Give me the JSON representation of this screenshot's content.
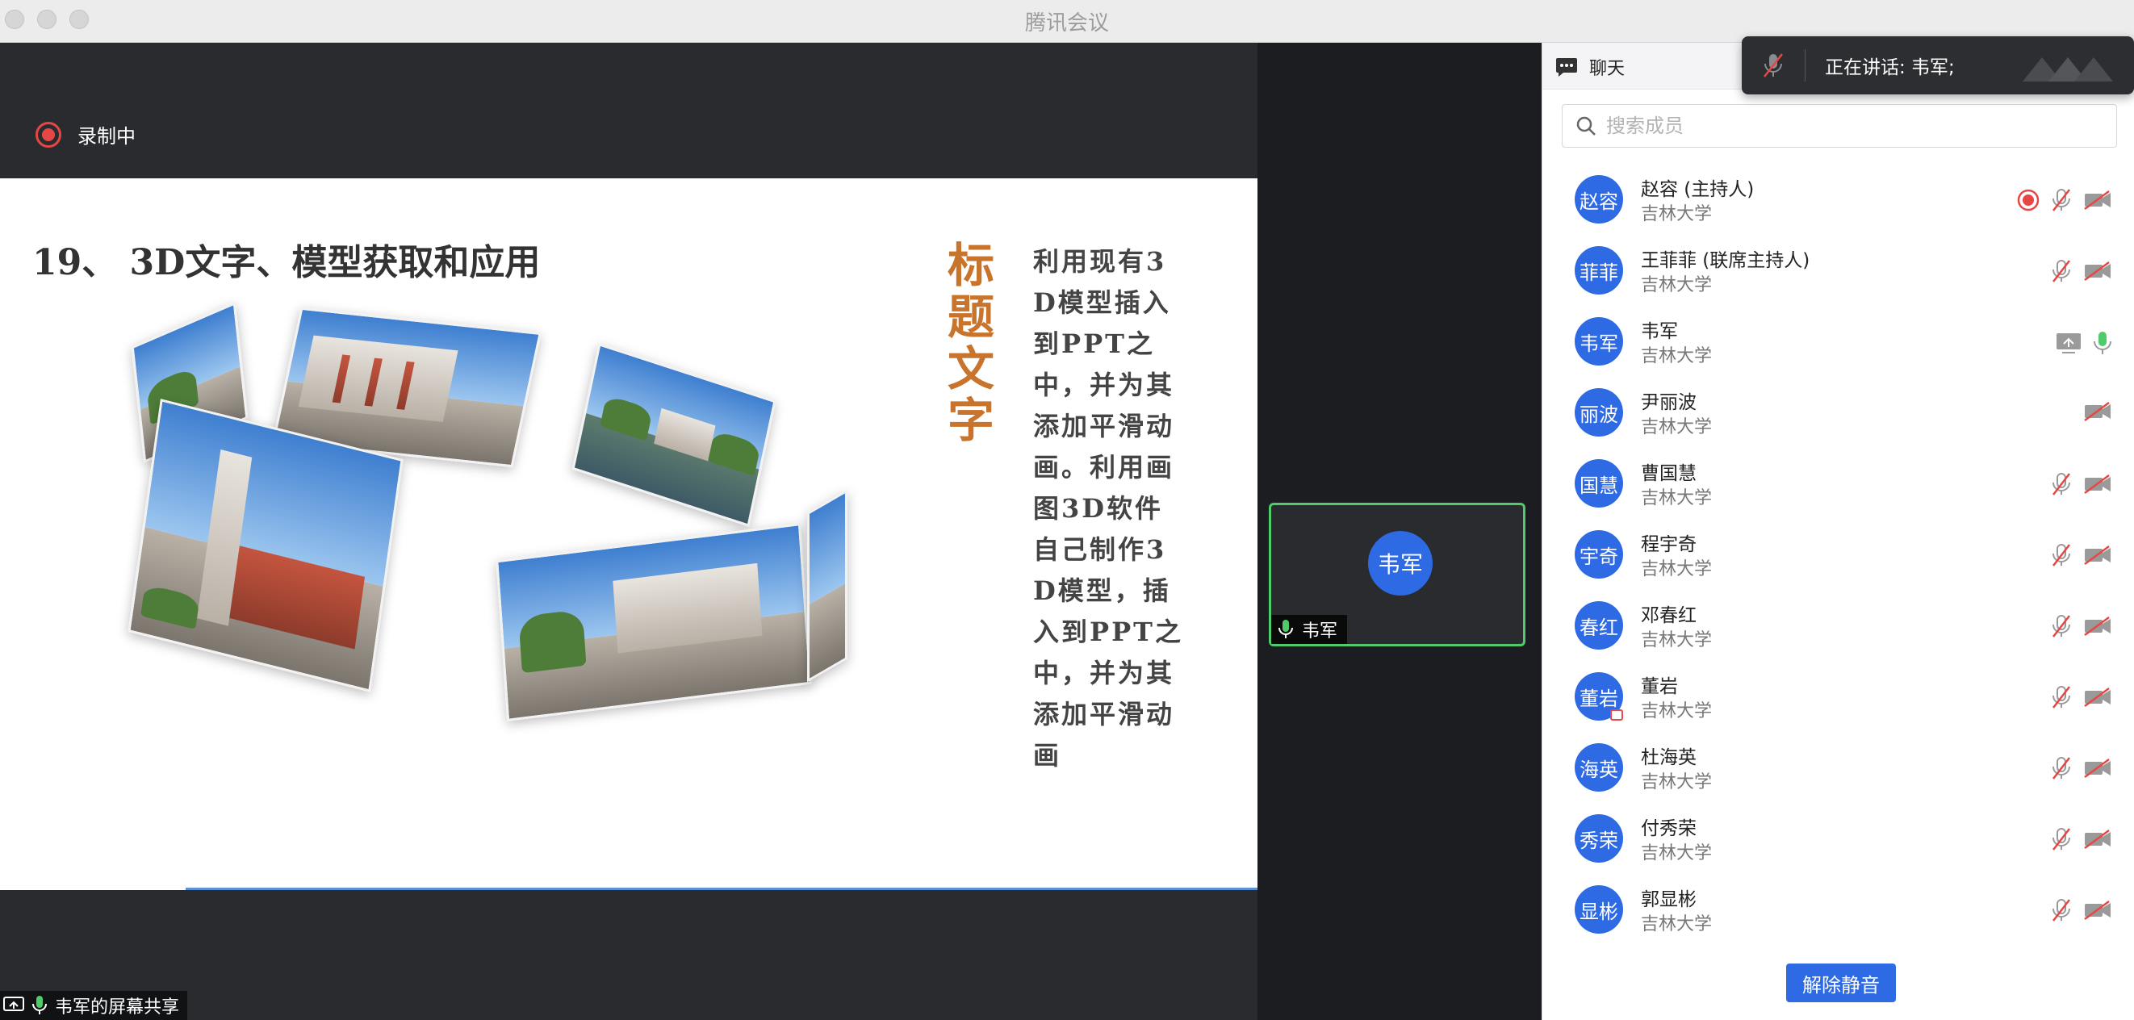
{
  "window": {
    "title": "腾讯会议"
  },
  "recording": {
    "label": "录制中",
    "status_color": "#e54844"
  },
  "slide": {
    "heading": "19、 3D文字、模型获取和应用",
    "vertical_title": "标题文字",
    "body": "利用现有3D模型插入到PPT之中，并为其添加平滑动画。利用画图3D软件自己制作3D模型，插入到PPT之中，并为其添加平滑动画"
  },
  "video_tile": {
    "avatar": "韦军",
    "name": "韦军",
    "border_color": "#4fcb6b"
  },
  "share_bar": {
    "label": "韦军的屏幕共享"
  },
  "panel": {
    "chat_tab": "聊天",
    "speaking_label": "正在讲话: 韦军;",
    "search_placeholder": "搜索成员",
    "accent_color": "#2f6ae5",
    "members": [
      {
        "avatar": "赵容",
        "name": "赵容 (主持人)",
        "org": "吉林大学",
        "icons": [
          "recording-icon",
          "mic-muted-icon",
          "video-off-icon"
        ]
      },
      {
        "avatar": "菲菲",
        "name": "王菲菲 (联席主持人)",
        "org": "吉林大学",
        "icons": [
          "mic-muted-icon",
          "video-off-icon"
        ]
      },
      {
        "avatar": "韦军",
        "name": "韦军",
        "org": "吉林大学",
        "icons": [
          "screen-share-icon",
          "mic-active-icon"
        ]
      },
      {
        "avatar": "丽波",
        "name": "尹丽波",
        "org": "吉林大学",
        "icons": [
          "video-off-icon"
        ]
      },
      {
        "avatar": "国慧",
        "name": "曹国慧",
        "org": "吉林大学",
        "icons": [
          "mic-muted-icon",
          "video-off-icon"
        ]
      },
      {
        "avatar": "宇奇",
        "name": "程宇奇",
        "org": "吉林大学",
        "icons": [
          "mic-muted-icon",
          "video-off-icon"
        ]
      },
      {
        "avatar": "春红",
        "name": "邓春红",
        "org": "吉林大学",
        "icons": [
          "mic-muted-icon",
          "video-off-icon"
        ]
      },
      {
        "avatar": "董岩",
        "name": "董岩",
        "org": "吉林大学",
        "icons": [
          "mic-muted-icon",
          "video-off-icon"
        ]
      },
      {
        "avatar": "海英",
        "name": "杜海英",
        "org": "吉林大学",
        "icons": [
          "mic-muted-icon",
          "video-off-icon"
        ]
      },
      {
        "avatar": "秀荣",
        "name": "付秀荣",
        "org": "吉林大学",
        "icons": [
          "mic-muted-icon",
          "video-off-icon"
        ]
      },
      {
        "avatar": "显彬",
        "name": "郭显彬",
        "org": "吉林大学",
        "icons": [
          "mic-muted-icon",
          "video-off-icon"
        ]
      }
    ],
    "unmute_button": "解除静音"
  }
}
